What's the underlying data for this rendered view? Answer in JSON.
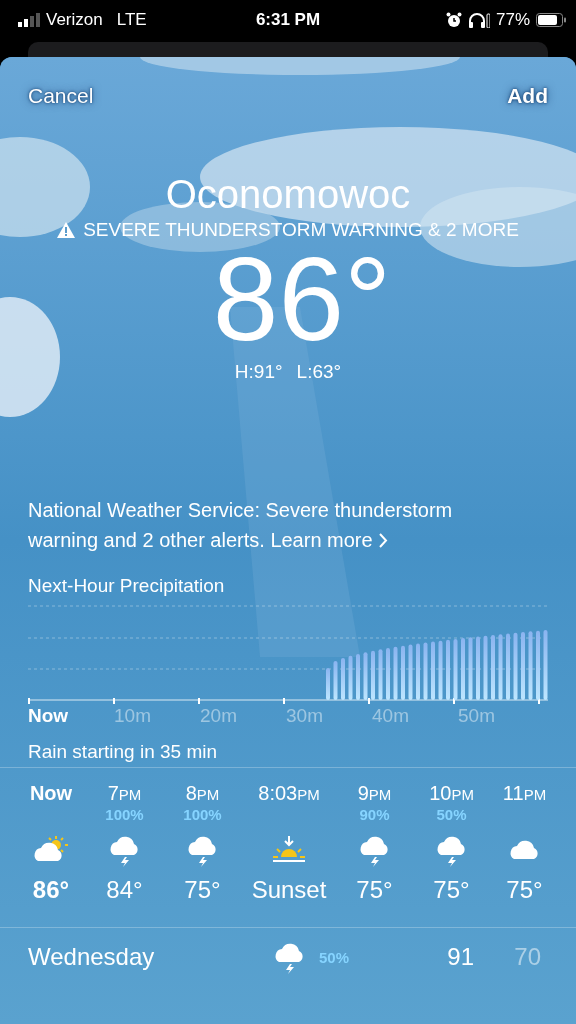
{
  "status_bar": {
    "carrier": "Verizon",
    "network": "LTE",
    "time": "6:31 PM",
    "battery": "77%"
  },
  "header": {
    "cancel": "Cancel",
    "add": "Add"
  },
  "location": {
    "city": "Oconomowoc",
    "alert": "SEVERE THUNDERSTORM WARNING & 2 MORE",
    "temperature": "86°",
    "high": "H:91°",
    "low": "L:63°"
  },
  "alert_notice": {
    "text": "National Weather Service: Severe thunderstorm warning and 2 other alerts.",
    "link": "Learn more"
  },
  "precipitation": {
    "title": "Next-Hour Precipitation",
    "axis_labels": [
      {
        "label": "Now",
        "selected": true
      },
      {
        "label": "10m",
        "selected": false
      },
      {
        "label": "20m",
        "selected": false
      },
      {
        "label": "30m",
        "selected": false
      },
      {
        "label": "40m",
        "selected": false
      },
      {
        "label": "50m",
        "selected": false
      }
    ],
    "summary": "Rain starting in 35 min"
  },
  "hourly": [
    {
      "time": "Now",
      "current": true,
      "kind": "partly-cloudy",
      "temperature": "86°"
    },
    {
      "time": "7",
      "suffix": "PM",
      "current": false,
      "chance": "100%",
      "kind": "thunderstorm",
      "temperature": "84°"
    },
    {
      "time": "8",
      "suffix": "PM",
      "current": false,
      "chance": "100%",
      "kind": "thunderstorm",
      "temperature": "75°"
    },
    {
      "time": "8:03",
      "suffix": "PM",
      "current": false,
      "kind": "sunset",
      "temperature": "Sunset"
    },
    {
      "time": "9",
      "suffix": "PM",
      "current": false,
      "chance": "90%",
      "kind": "thunderstorm",
      "temperature": "75°"
    },
    {
      "time": "10",
      "suffix": "PM",
      "current": false,
      "chance": "50%",
      "kind": "thunderstorm",
      "temperature": "75°"
    },
    {
      "time": "11",
      "suffix": "PM",
      "current": false,
      "kind": "cloudy",
      "temperature": "75°"
    }
  ],
  "daily": [
    {
      "day": "Wednesday",
      "kind": "thunderstorm",
      "chance": "50%",
      "high": "91",
      "low": "70"
    }
  ]
}
